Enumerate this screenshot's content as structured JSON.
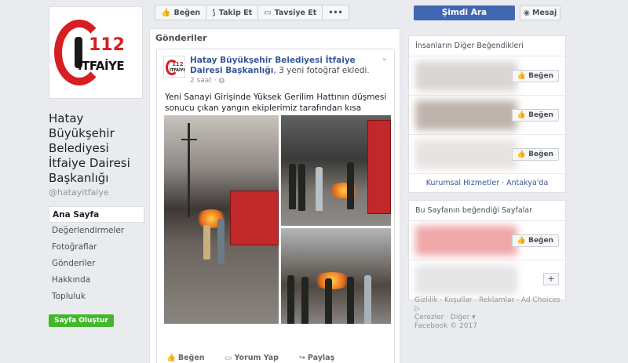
{
  "page": {
    "name": "Hatay Büyükşehir Belediyesi İtfaiye Dairesi Başkanlığı",
    "handle": "@hatayitfaiye",
    "logo_number": "112",
    "logo_word": "İTFAİYE"
  },
  "nav": {
    "items": [
      {
        "label": "Ana Sayfa"
      },
      {
        "label": "Değerlendirmeler"
      },
      {
        "label": "Fotoğraflar"
      },
      {
        "label": "Gönderiler"
      },
      {
        "label": "Hakkında"
      },
      {
        "label": "Topluluk"
      }
    ],
    "create_label": "Sayfa Oluştur"
  },
  "actionbar": {
    "like": "Beğen",
    "follow": "Takip Et",
    "recommend": "Tavsiye Et",
    "more": "•••"
  },
  "cta": {
    "call": "Şimdi Ara",
    "message": "Mesaj"
  },
  "posts": {
    "title": "Gönderiler",
    "post": {
      "author": "Hatay Büyükşehir Belediyesi İtfaiye Dairesi Başkanlığı",
      "action": ", 3 yeni fotoğraf ekledi.",
      "time": "2 saat",
      "text": "Yeni Sanayi Girişinde Yüksek Gerilim Hattının düşmesi sonucu çıkan yangın ekiplerimiz tarafından kısa sürede söndürüldü.",
      "like": "Beğen",
      "comment": "Yorum Yap",
      "share": "Paylaş"
    }
  },
  "right": {
    "others_title": "İnsanların Diğer Beğendikleri",
    "like_label": "Beğen",
    "others_link": "Kurumsal Hizmetler · Antakya'da",
    "liked_title": "Bu Sayfanın beğendiği Sayfalar",
    "plus": "+",
    "colors": [
      "#d9d6d4",
      "#bfb4ad",
      "#e7e3e1",
      "#f0a7a9",
      "#e5e5e5"
    ]
  },
  "footer": {
    "line1": "Gizlilik · Koşullar · Reklamlar · Ad Choices ▷",
    "line2": "Çerezler · Diğer ▾",
    "line3": "Facebook © 2017"
  }
}
